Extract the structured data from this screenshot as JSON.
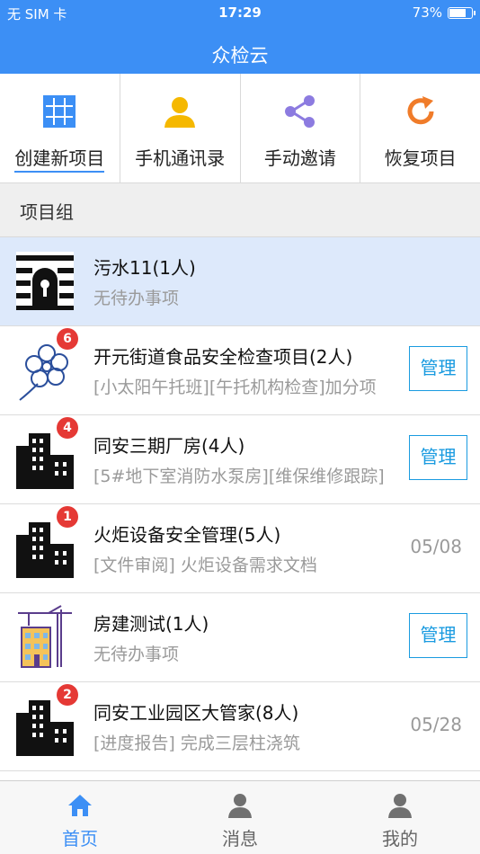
{
  "status_bar": {
    "carrier": "无 SIM 卡",
    "time": "17:29",
    "battery": "73%"
  },
  "header": {
    "title": "众检云"
  },
  "toolbar": {
    "items": [
      {
        "label": "创建新项目",
        "icon": "grid-icon"
      },
      {
        "label": "手机通讯录",
        "icon": "contact-person-icon"
      },
      {
        "label": "手动邀请",
        "icon": "share-icon"
      },
      {
        "label": "恢复项目",
        "icon": "refresh-icon"
      }
    ]
  },
  "section": {
    "title": "项目组"
  },
  "projects": [
    {
      "name": "污水11(1人)",
      "sub": "无待办事项",
      "badge": "",
      "action": "",
      "date": "",
      "icon": "sewer-icon",
      "highlight": true
    },
    {
      "name": "开元街道食品安全检查项目(2人)",
      "sub": "[小太阳午托班][午托机构检查]加分项",
      "badge": "6",
      "action": "管理",
      "date": "",
      "icon": "flower-icon"
    },
    {
      "name": "同安三期厂房(4人)",
      "sub": "[5#地下室消防水泵房][维保维修跟踪]",
      "badge": "4",
      "action": "管理",
      "date": "",
      "icon": "building-icon"
    },
    {
      "name": "火炬设备安全管理(5人)",
      "sub": "[文件审阅] 火炬设备需求文档",
      "badge": "1",
      "action": "",
      "date": "05/08",
      "icon": "building-icon"
    },
    {
      "name": "房建测试(1人)",
      "sub": "无待办事项",
      "badge": "",
      "action": "管理",
      "date": "",
      "icon": "crane-building-icon"
    },
    {
      "name": "同安工业园区大管家(8人)",
      "sub": "[进度报告] 完成三层柱浇筑",
      "badge": "2",
      "action": "",
      "date": "05/28",
      "icon": "building-icon"
    }
  ],
  "tabbar": {
    "items": [
      {
        "label": "首页",
        "icon": "home-icon"
      },
      {
        "label": "消息",
        "icon": "person-icon"
      },
      {
        "label": "我的",
        "icon": "person-icon"
      }
    ]
  },
  "colors": {
    "primary": "#3c8ff5",
    "badge": "#e53935",
    "manage": "#1a9be0"
  }
}
